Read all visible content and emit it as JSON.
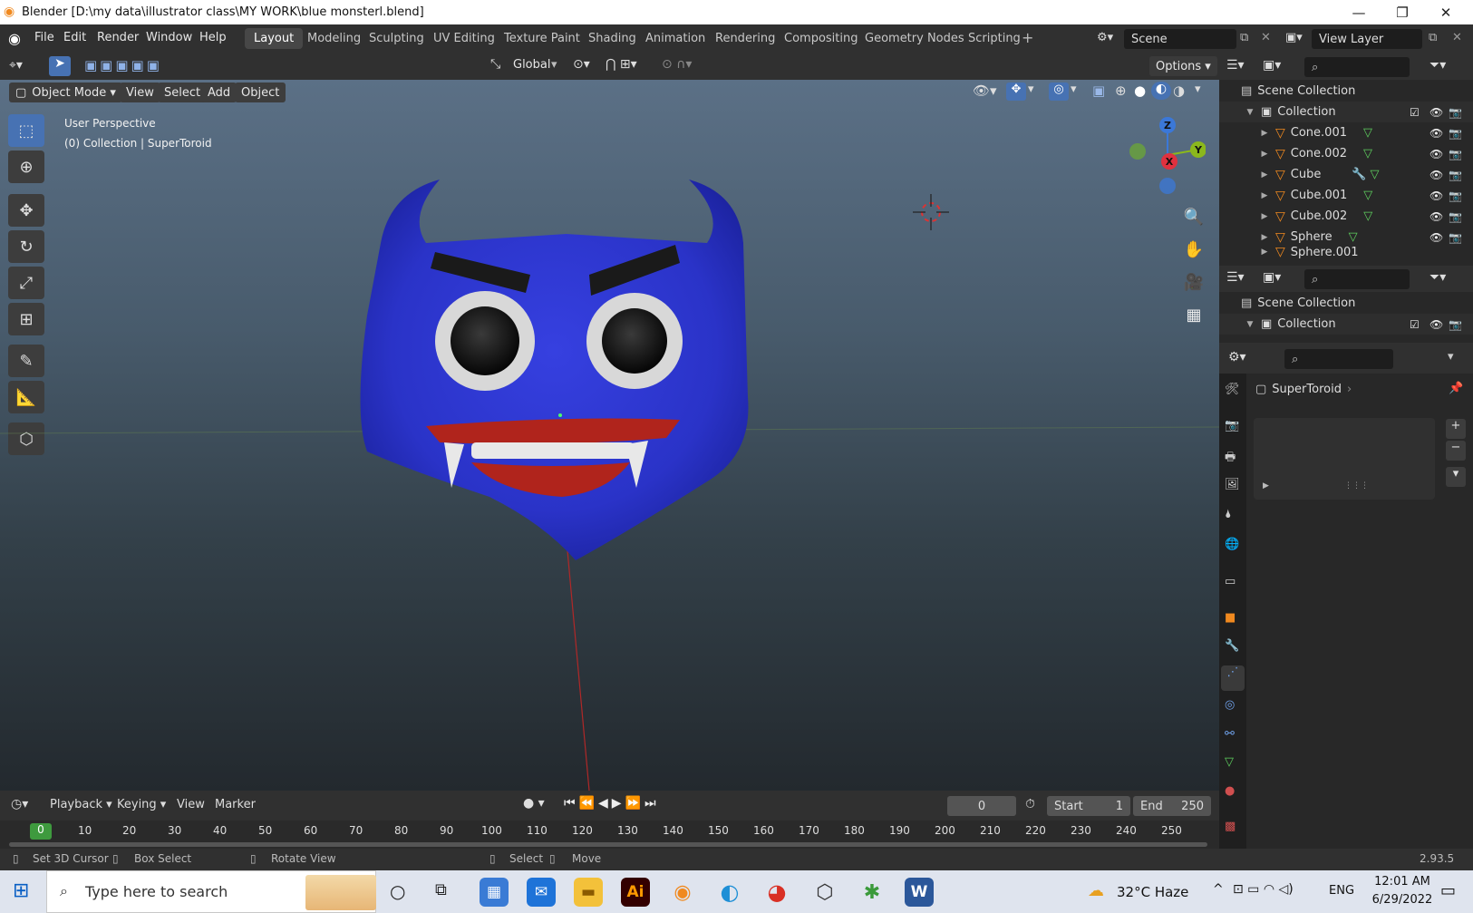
{
  "window": {
    "title": "Blender [D:\\my data\\illustrator class\\MY WORK\\blue monsterl.blend]"
  },
  "menu": [
    "File",
    "Edit",
    "Render",
    "Window",
    "Help"
  ],
  "workspaces": [
    "Layout",
    "Modeling",
    "Sculpting",
    "UV Editing",
    "Texture Paint",
    "Shading",
    "Animation",
    "Rendering",
    "Compositing",
    "Geometry Nodes",
    "Scripting"
  ],
  "active_workspace": "Layout",
  "scene": "Scene",
  "view_layer": "View Layer",
  "toolheader": {
    "transform_orientation": "Global",
    "options": "Options"
  },
  "viewport_header": {
    "mode": "Object Mode",
    "view": "View",
    "select": "Select",
    "add": "Add",
    "object": "Object"
  },
  "viewport": {
    "perspective": "User Perspective",
    "collection_info": "(0) Collection | SuperToroid",
    "gizmo": {
      "z": "Z",
      "x": "X",
      "y": "Y"
    }
  },
  "outliner": {
    "scene_collection": "Scene Collection",
    "collection": "Collection",
    "objects": [
      "Cone.001",
      "Cone.002",
      "Cube",
      "Cube.001",
      "Cube.002",
      "Sphere",
      "Sphere.001"
    ]
  },
  "outliner2": {
    "scene_collection": "Scene Collection",
    "collection": "Collection"
  },
  "properties": {
    "object_name": "SuperToroid"
  },
  "timeline": {
    "playback": "Playback",
    "keying": "Keying",
    "view": "View",
    "marker": "Marker",
    "current_frame": "0",
    "start_label": "Start",
    "start": "1",
    "end_label": "End",
    "end": "250",
    "ruler": [
      "0",
      "10",
      "20",
      "30",
      "40",
      "50",
      "60",
      "70",
      "80",
      "90",
      "100",
      "110",
      "120",
      "130",
      "140",
      "150",
      "160",
      "170",
      "180",
      "190",
      "200",
      "210",
      "220",
      "230",
      "240",
      "250"
    ]
  },
  "statusbar": {
    "set_cursor": "Set 3D Cursor",
    "box_select": "Box Select",
    "rotate_view": "Rotate View",
    "select": "Select",
    "move": "Move",
    "version": "2.93.5"
  },
  "taskbar": {
    "search_placeholder": "Type here to search",
    "weather": "32°C  Haze",
    "lang": "ENG",
    "time": "12:01 AM",
    "date": "6/29/2022"
  },
  "colors": {
    "accent": "#4772b3",
    "monster_blue": "#2a33c8",
    "lips": "#b0241c",
    "object_orange": "#f0891f"
  }
}
